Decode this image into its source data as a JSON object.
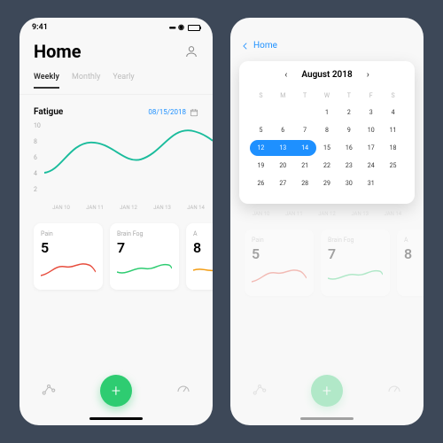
{
  "status": {
    "time": "9:41"
  },
  "screen1": {
    "title": "Home",
    "tabs": [
      "Weekly",
      "Monthly",
      "Yearly"
    ],
    "active_tab": "Weekly",
    "chart_title": "Fatigue",
    "selected_date": "08/15/2018",
    "cards": [
      {
        "label": "Pain",
        "value": "5",
        "color": "#e74c3c"
      },
      {
        "label": "Brain Fog",
        "value": "7",
        "color": "#2ecc71"
      },
      {
        "label": "A",
        "value": "8",
        "color": "#f39c12"
      }
    ]
  },
  "screen2": {
    "back_label": "Home",
    "month_label": "August 2018",
    "dow": [
      "S",
      "M",
      "T",
      "W",
      "T",
      "F",
      "S"
    ],
    "first_day_offset": 3,
    "days_in_month": 31,
    "selection": {
      "start": 12,
      "end": 14
    },
    "cards": [
      {
        "label": "Pain",
        "value": "5",
        "color": "#e74c3c"
      },
      {
        "label": "Brain Fog",
        "value": "7",
        "color": "#2ecc71"
      },
      {
        "label": "A",
        "value": "8",
        "color": "#f39c12"
      }
    ]
  },
  "chart_data": {
    "type": "line",
    "title": "Fatigue",
    "xlabel": "",
    "ylabel": "",
    "ylim": [
      2,
      10
    ],
    "categories": [
      "JAN 10",
      "JAN 11",
      "JAN 12",
      "JAN 13",
      "JAN 14"
    ],
    "series": [
      {
        "name": "Fatigue",
        "values": [
          4,
          7,
          5.5,
          9,
          8
        ],
        "color": "#1abc9c"
      }
    ],
    "y_ticks": [
      10,
      8,
      6,
      4,
      2
    ]
  },
  "colors": {
    "accent_blue": "#1e90ff",
    "accent_green": "#2ecc71",
    "teal": "#1abc9c"
  }
}
